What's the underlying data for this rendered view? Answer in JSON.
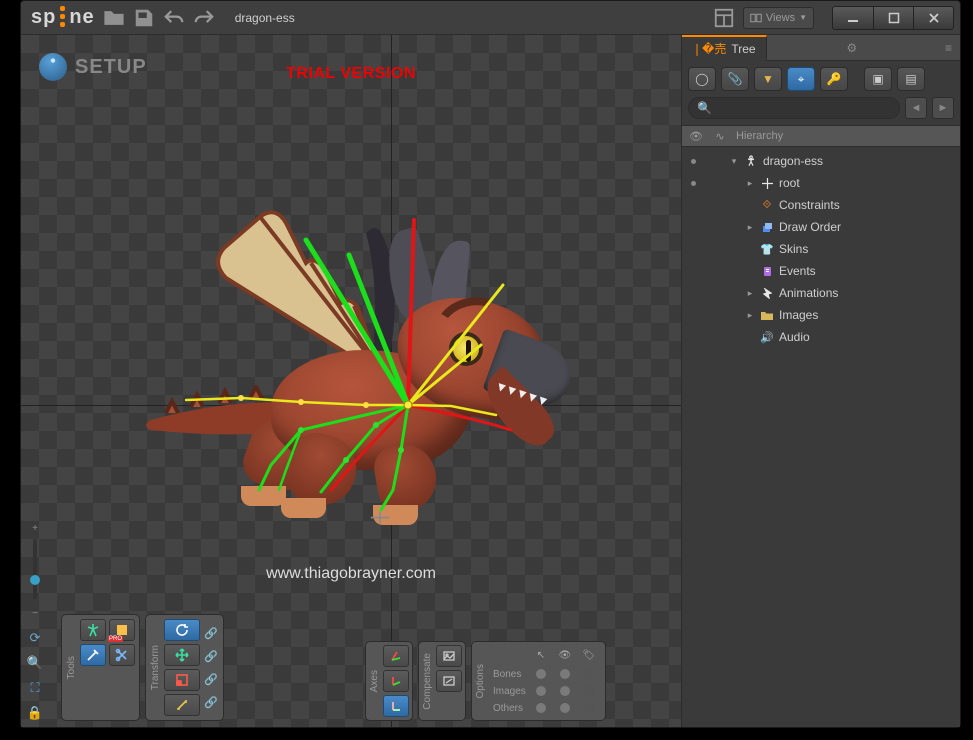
{
  "app": {
    "logo": "sp ne",
    "doc": "dragon-ess"
  },
  "viewsLabel": "Views",
  "mode": "SETUP",
  "watermark": "TRIAL VERSION",
  "url": "www.thiagobrayner.com",
  "treeTab": "Tree",
  "hierLabel": "Hierarchy",
  "searchPlaceholder": "",
  "toolbars": {
    "tools": "Tools",
    "transform": "Transform",
    "axes": "Axes",
    "compensate": "Compensate",
    "options": "Options"
  },
  "optionsRows": [
    "Bones",
    "Images",
    "Others"
  ],
  "tree": [
    {
      "d": 0,
      "open": true,
      "icon": "skeleton",
      "color": "#e8e8e8",
      "label": "dragon-ess",
      "vis": true
    },
    {
      "d": 1,
      "open": false,
      "icon": "crosshair",
      "color": "#e8e8e8",
      "label": "root",
      "vis": true
    },
    {
      "d": 1,
      "open": null,
      "icon": "constraint",
      "color": "#ff8a2a",
      "label": "Constraints",
      "vis": null
    },
    {
      "d": 1,
      "open": false,
      "icon": "draworder",
      "color": "#4f8df0",
      "label": "Draw Order",
      "vis": null
    },
    {
      "d": 1,
      "open": null,
      "icon": "skin",
      "color": "#ff8a2a",
      "label": "Skins",
      "vis": null
    },
    {
      "d": 1,
      "open": null,
      "icon": "event",
      "color": "#b06be6",
      "label": "Events",
      "vis": null
    },
    {
      "d": 1,
      "open": false,
      "icon": "anim",
      "color": "#e8e8e8",
      "label": "Animations",
      "vis": null
    },
    {
      "d": 1,
      "open": false,
      "icon": "folder",
      "color": "#d7b85a",
      "label": "Images",
      "vis": null
    },
    {
      "d": 1,
      "open": null,
      "icon": "audio",
      "color": "#66c06a",
      "label": "Audio",
      "vis": null
    }
  ]
}
